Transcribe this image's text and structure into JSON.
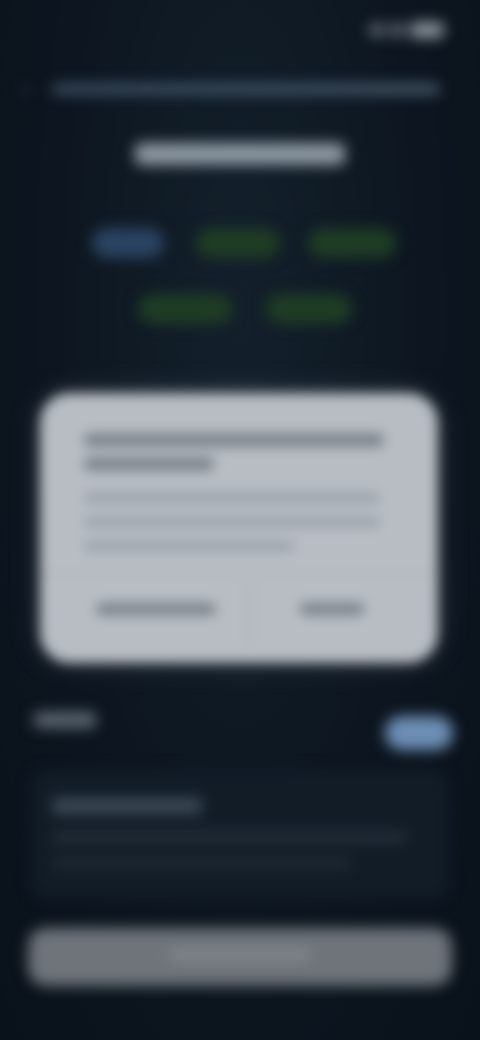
{
  "colors": {
    "background": "#0d1620",
    "dialog": "#b7bdc3",
    "toggle_accent": "#6d8fb5",
    "pill_blue": "#2b4462",
    "pill_green": "#1f3d25"
  },
  "status_bar": {
    "time": "",
    "icons": [
      "signal-icon",
      "wifi-icon",
      "battery-icon"
    ]
  },
  "browser": {
    "back_icon": "chevron-left-icon",
    "url": ""
  },
  "page": {
    "heading": "",
    "choices": [
      "",
      "",
      "",
      "",
      ""
    ],
    "section_label": "",
    "info_title": "",
    "bottom_button": ""
  },
  "dialog": {
    "title": "",
    "body": "",
    "left_button": "",
    "right_button": ""
  }
}
